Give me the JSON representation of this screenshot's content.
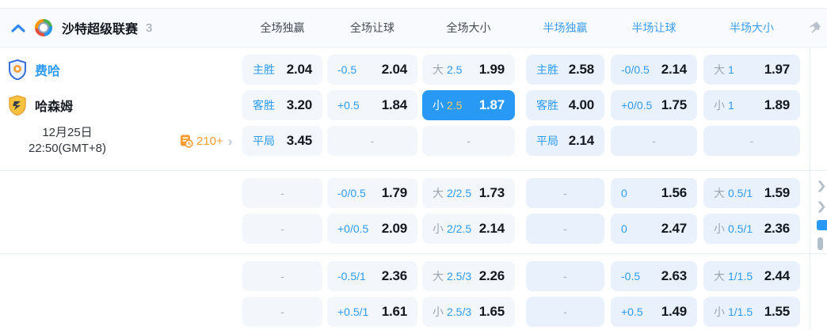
{
  "header": {
    "league": "沙特超级联赛",
    "count": "3",
    "columns": [
      {
        "label": "全场独赢",
        "half": false
      },
      {
        "label": "全场让球",
        "half": false
      },
      {
        "label": "全场大小",
        "half": false
      },
      {
        "label": "半场独赢",
        "half": true
      },
      {
        "label": "半场让球",
        "half": true
      },
      {
        "label": "半场大小",
        "half": true
      }
    ]
  },
  "match": {
    "home_team": "费哈",
    "away_team": "哈森姆",
    "date_line1": "12月25日",
    "date_line2": "22:50(GMT+8)",
    "more_markets": "210+"
  },
  "odds_groups": [
    {
      "rows": [
        {
          "cells": [
            {
              "label": "主胜",
              "value": "2.04"
            },
            {
              "label": "-0.5",
              "value": "2.04"
            },
            {
              "prefix": "大",
              "line": "2.5",
              "value": "1.99"
            },
            {
              "label": "主胜",
              "value": "2.58"
            },
            {
              "label": "-0/0.5",
              "value": "2.14"
            },
            {
              "prefix": "大",
              "line": "1",
              "value": "1.97"
            }
          ]
        },
        {
          "cells": [
            {
              "label": "客胜",
              "value": "3.20"
            },
            {
              "label": "+0.5",
              "value": "1.84"
            },
            {
              "prefix": "小",
              "line": "2.5",
              "value": "1.87",
              "selected": true
            },
            {
              "label": "客胜",
              "value": "4.00"
            },
            {
              "label": "+0/0.5",
              "value": "1.75"
            },
            {
              "prefix": "小",
              "line": "1",
              "value": "1.89"
            }
          ]
        },
        {
          "cells": [
            {
              "label": "平局",
              "value": "3.45"
            },
            {
              "dash": true
            },
            {
              "dash": true
            },
            {
              "label": "平局",
              "value": "2.14"
            },
            {
              "dash": true
            },
            {
              "dash": true
            }
          ]
        }
      ]
    },
    {
      "rows": [
        {
          "cells": [
            {
              "dash": true
            },
            {
              "label": "-0/0.5",
              "value": "1.79"
            },
            {
              "prefix": "大",
              "line": "2/2.5",
              "value": "1.73"
            },
            {
              "dash": true
            },
            {
              "label": "0",
              "value": "1.56"
            },
            {
              "prefix": "大",
              "line": "0.5/1",
              "value": "1.59"
            }
          ]
        },
        {
          "cells": [
            {
              "dash": true
            },
            {
              "label": "+0/0.5",
              "value": "2.09"
            },
            {
              "prefix": "小",
              "line": "2/2.5",
              "value": "2.14"
            },
            {
              "dash": true
            },
            {
              "label": "0",
              "value": "2.47"
            },
            {
              "prefix": "小",
              "line": "0.5/1",
              "value": "2.36"
            }
          ]
        }
      ]
    },
    {
      "rows": [
        {
          "cells": [
            {
              "dash": true
            },
            {
              "label": "-0.5/1",
              "value": "2.36"
            },
            {
              "prefix": "大",
              "line": "2.5/3",
              "value": "2.26"
            },
            {
              "dash": true
            },
            {
              "label": "-0.5",
              "value": "2.63"
            },
            {
              "prefix": "大",
              "line": "1/1.5",
              "value": "2.44"
            }
          ]
        },
        {
          "cells": [
            {
              "dash": true
            },
            {
              "label": "+0.5/1",
              "value": "1.61"
            },
            {
              "prefix": "小",
              "line": "2.5/3",
              "value": "1.65"
            },
            {
              "dash": true
            },
            {
              "label": "+0.5",
              "value": "1.49"
            },
            {
              "prefix": "小",
              "line": "1/1.5",
              "value": "1.55"
            }
          ]
        }
      ]
    }
  ],
  "dash_char": "-",
  "icons": {
    "collapse": "chevron-up",
    "league": "multicolor-ring",
    "pin": "pushpin",
    "event_count": "calendar-clock",
    "more_arrow": "chevron-right",
    "home_crest": "blue-shield",
    "away_crest": "yellow-shield"
  },
  "colors": {
    "accent_blue": "#2e9bf5",
    "selected_bg": "#2899f5",
    "selected_line_gold": "#f4c96d",
    "orange": "#f79d34",
    "cell_full_bg": "#f3f6fa",
    "cell_half_bg": "#e9f2fc",
    "value_text": "#14181f",
    "muted_gray": "#9aa5b0",
    "border": "#e9eef4"
  }
}
